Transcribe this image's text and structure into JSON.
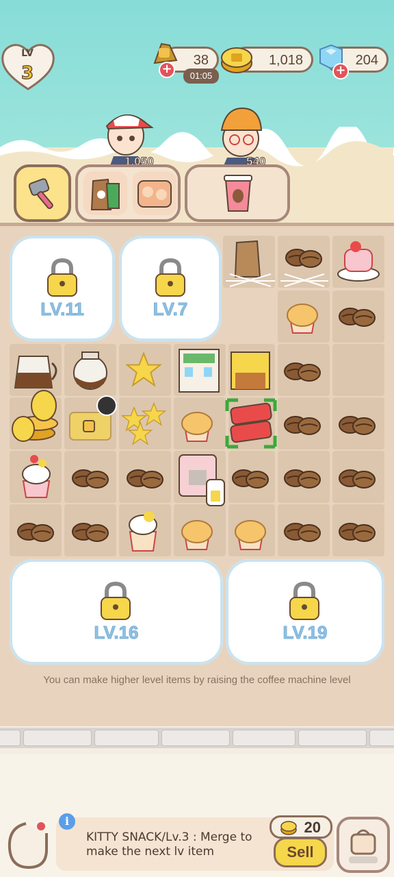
{
  "player": {
    "level_label": "LV",
    "level": "3"
  },
  "currencies": {
    "energy": {
      "value": "38",
      "timer": "01:05"
    },
    "coins": {
      "value": "1,018"
    },
    "gems": {
      "value": "204"
    }
  },
  "customers": [
    {
      "reward": "1,050"
    },
    {
      "reward": "540"
    }
  ],
  "locked_areas": [
    {
      "label": "LV.11"
    },
    {
      "label": "LV.7"
    },
    {
      "label": "LV.16"
    },
    {
      "label": "LV.19"
    }
  ],
  "hint": "You can make higher level items by raising the coffee machine level",
  "selected_item": {
    "description": "KITTY SNACK/Lv.3 : Merge to make the next lv item",
    "sell_price": "20",
    "sell_label": "Sell"
  },
  "icons": [
    "hammer-icon",
    "coffee-bag-icon",
    "kitty-snack-icon",
    "coffee-cup-icon",
    "coffee-bean-icon",
    "muffin-icon",
    "star-icon",
    "cupcake-icon",
    "coffee-pot-icon",
    "coin-stack-icon",
    "treasure-chest-icon",
    "coffee-machine-icon",
    "cafe-building-icon",
    "roll-cake-icon",
    "lock-icon",
    "back-icon",
    "info-icon",
    "bag-icon"
  ],
  "colors": {
    "accent": "#f6d64a",
    "lock": "#8fc1e3",
    "frame": "#8a6d5a"
  }
}
